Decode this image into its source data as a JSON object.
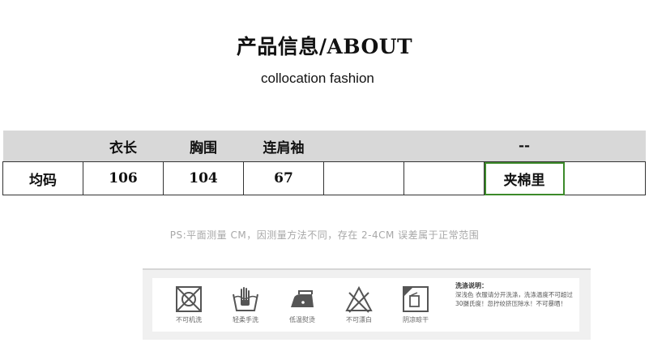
{
  "header": {
    "title": "产品信息/ABOUT",
    "subtitle": "collocation fashion"
  },
  "size_table": {
    "columns": [
      "",
      "衣长",
      "胸围",
      "连肩袖",
      "",
      "",
      "--",
      ""
    ],
    "rows": [
      [
        "均码",
        "106",
        "104",
        "67",
        "",
        "",
        "夹棉里",
        ""
      ]
    ]
  },
  "note": "PS:平面测量 CM，因测量方法不同，存在 2-4CM 误差属于正常范围",
  "care": {
    "items": [
      {
        "icon": "no-machine-wash-icon",
        "label": "不可机洗"
      },
      {
        "icon": "gentle-hand-wash-icon",
        "label": "轻柔手洗"
      },
      {
        "icon": "low-temp-iron-icon",
        "label": "低温熨烫"
      },
      {
        "icon": "no-bleach-icon",
        "label": "不可漂白"
      },
      {
        "icon": "shade-dry-icon",
        "label": "阴凉晾干"
      }
    ],
    "instructions_title": "洗涤说明：",
    "instructions_body": "深浅色 衣服请分开洗涤，洗涤温度不可超过30摄氏度！忽拧绞挤压除水！不可暴晒！"
  }
}
